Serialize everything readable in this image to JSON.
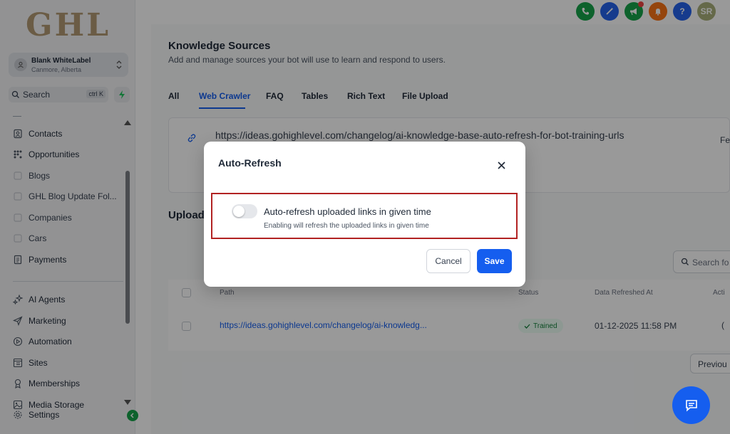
{
  "brand": {
    "logo_text": "GHL"
  },
  "account": {
    "name": "Blank WhiteLabel",
    "location": "Canmore, Alberta"
  },
  "search": {
    "label": "Search",
    "shortcut": "ctrl K"
  },
  "sidebar": {
    "items": [
      {
        "label": "Contacts",
        "icon": "contacts-icon"
      },
      {
        "label": "Opportunities",
        "icon": "opportunities-icon"
      },
      {
        "label": "Blogs",
        "icon": "blogs-icon"
      },
      {
        "label": "GHL Blog Update Fol...",
        "icon": "folder-icon"
      },
      {
        "label": "Companies",
        "icon": "companies-icon"
      },
      {
        "label": "Cars",
        "icon": "cars-icon"
      },
      {
        "label": "Payments",
        "icon": "payments-icon"
      },
      {
        "label": "AI Agents",
        "icon": "sparkle-icon"
      },
      {
        "label": "Marketing",
        "icon": "send-icon"
      },
      {
        "label": "Automation",
        "icon": "automation-icon"
      },
      {
        "label": "Sites",
        "icon": "sites-icon"
      },
      {
        "label": "Memberships",
        "icon": "memberships-icon"
      },
      {
        "label": "Media Storage",
        "icon": "media-icon"
      },
      {
        "label": "Settings",
        "icon": "gear-icon"
      }
    ]
  },
  "topbar": {
    "avatar_initials": "SR",
    "colors": {
      "phone": "#16a34a",
      "magic": "#2563eb",
      "announce": "#16a34a",
      "bell": "#f97316",
      "help": "#2563eb",
      "avatar": "#a8b07a"
    }
  },
  "page": {
    "title": "Knowledge Sources",
    "subtitle": "Add and manage sources your bot will use to learn and respond to users.",
    "tabs": [
      "All",
      "Web Crawler",
      "FAQ",
      "Tables",
      "Rich Text",
      "File Upload"
    ],
    "active_tab": "Web Crawler",
    "crawler_url": "https://ideas.gohighlevel.com/changelog/ai-knowledge-base-auto-refresh-for-bot-training-urls",
    "crawler_right": "Fe",
    "uploaded_heading": "Upload",
    "table_search_placeholder": "Search fo",
    "columns": {
      "path": "Path",
      "status": "Status",
      "refreshed": "Data Refreshed At",
      "actions": "Acti"
    },
    "rows": [
      {
        "path": "https://ideas.gohighlevel.com/changelog/ai-knowledg...",
        "status": "Trained",
        "refreshed": "01-12-2025 11:58 PM",
        "action": "("
      }
    ],
    "pagination_prev": "Previou"
  },
  "modal": {
    "title": "Auto-Refresh",
    "toggle_label": "Auto-refresh uploaded links in given time",
    "toggle_help": "Enabling will refresh the uploaded links in given time",
    "toggle_on": false,
    "cancel_label": "Cancel",
    "save_label": "Save",
    "highlight_color": "#b22222"
  },
  "accent_color": "#155eef"
}
